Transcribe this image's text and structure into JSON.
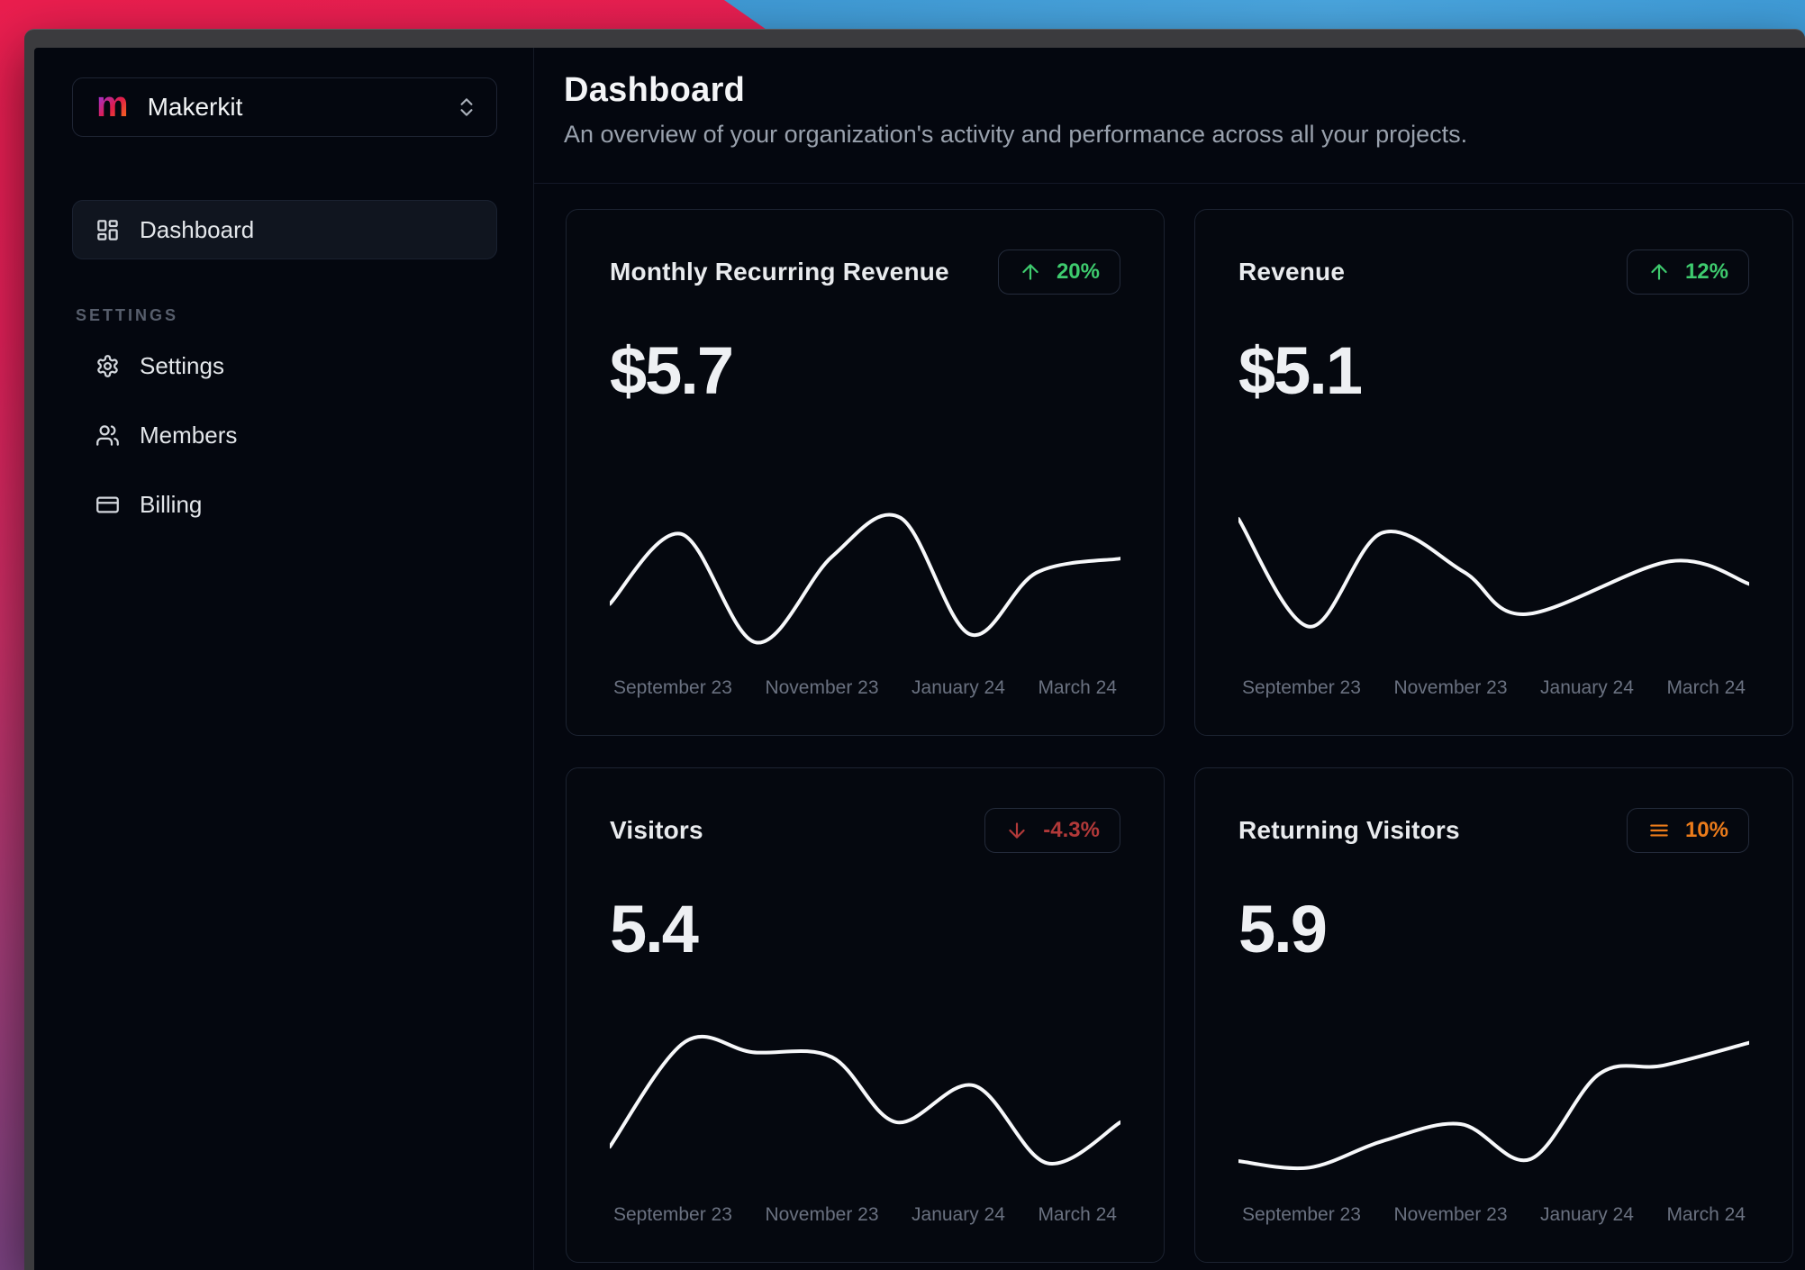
{
  "sidebar": {
    "workspace": {
      "logo_letter": "m",
      "name": "Makerkit"
    },
    "nav": [
      {
        "label": "Dashboard",
        "icon": "dashboard-grid-icon",
        "active": true
      }
    ],
    "section_label": "SETTINGS",
    "settings_nav": [
      {
        "label": "Settings",
        "icon": "gear-icon"
      },
      {
        "label": "Members",
        "icon": "users-icon"
      },
      {
        "label": "Billing",
        "icon": "credit-card-icon"
      }
    ]
  },
  "header": {
    "title": "Dashboard",
    "subtitle": "An overview of your organization's activity and performance across all your projects."
  },
  "cards": [
    {
      "title": "Monthly Recurring Revenue",
      "value": "$5.7",
      "badge": "20%",
      "trend": "up",
      "badge_icon": "arrow-up-icon"
    },
    {
      "title": "Revenue",
      "value": "$5.1",
      "badge": "12%",
      "trend": "up",
      "badge_icon": "arrow-up-icon"
    },
    {
      "title": "Visitors",
      "value": "5.4",
      "badge": "-4.3%",
      "trend": "down",
      "badge_icon": "arrow-down-icon"
    },
    {
      "title": "Returning Visitors",
      "value": "5.9",
      "badge": "10%",
      "trend": "flat",
      "badge_icon": "menu-lines-icon"
    }
  ],
  "chart_data": [
    {
      "type": "line",
      "title": "Monthly Recurring Revenue sparkline",
      "categories": [
        "September 23",
        "November 23",
        "January 24",
        "March 24"
      ],
      "points_space": "x 0-100 left to right, y 0-40 top-down screen space (sparkline, no value axis shown)",
      "points": [
        [
          0,
          26.8
        ],
        [
          14,
          8.3
        ],
        [
          28.7,
          37
        ],
        [
          43.5,
          14.3
        ],
        [
          56.9,
          4
        ],
        [
          70.5,
          34.8
        ],
        [
          83.6,
          18.5
        ],
        [
          100,
          14.8
        ]
      ]
    },
    {
      "type": "line",
      "title": "Revenue sparkline",
      "categories": [
        "September 23",
        "November 23",
        "January 24",
        "March 24"
      ],
      "points_space": "x 0-100 left to right, y 0-40 top-down screen space (sparkline, no value axis shown)",
      "points": [
        [
          0,
          4.3
        ],
        [
          13.9,
          32.8
        ],
        [
          28.1,
          8
        ],
        [
          44.1,
          18.3
        ],
        [
          56.3,
          29.5
        ],
        [
          84.6,
          15.5
        ],
        [
          100,
          21.5
        ]
      ]
    },
    {
      "type": "line",
      "title": "Visitors sparkline",
      "categories": [
        "September 23",
        "November 23",
        "January 24",
        "March 24"
      ],
      "points_space": "x 0-100 left to right, y 0-40 top-down screen space (sparkline, no value axis shown)",
      "points": [
        [
          0,
          31
        ],
        [
          14.7,
          3.3
        ],
        [
          28,
          6
        ],
        [
          43.5,
          7.3
        ],
        [
          56.1,
          24.5
        ],
        [
          71.3,
          14.8
        ],
        [
          85.6,
          35.3
        ],
        [
          100,
          24.5
        ]
      ]
    },
    {
      "type": "line",
      "title": "Returning Visitors sparkline",
      "categories": [
        "September 23",
        "November 23",
        "January 24",
        "March 24"
      ],
      "points_space": "x 0-100 left to right, y 0-40 top-down screen space (sparkline, no value axis shown)",
      "points": [
        [
          0,
          34.8
        ],
        [
          13.9,
          36.5
        ],
        [
          28.2,
          29.5
        ],
        [
          43.5,
          25
        ],
        [
          57.1,
          34.3
        ],
        [
          70.6,
          11.8
        ],
        [
          83.2,
          9.5
        ],
        [
          100,
          3.5
        ]
      ]
    }
  ],
  "colors": {
    "page_bg": "#04070f",
    "card_bg": "#05080f",
    "card_border": "#1c2331",
    "window_frame": "#3b3b3e",
    "green": "#3ecb6e",
    "red": "#b23939",
    "orange": "#ec7c1b",
    "text_primary": "#eef0f3",
    "text_muted": "#99a1ad",
    "axis_label": "#6a7180",
    "wallpaper_pink": "#e81e4e",
    "wallpaper_purple": "#5d4580",
    "wallpaper_blue": "#449fda"
  },
  "icons": [
    "makerkit-logo",
    "chevrons-up-down-icon",
    "dashboard-grid-icon",
    "gear-icon",
    "users-icon",
    "credit-card-icon",
    "arrow-up-icon",
    "arrow-down-icon",
    "menu-lines-icon"
  ]
}
